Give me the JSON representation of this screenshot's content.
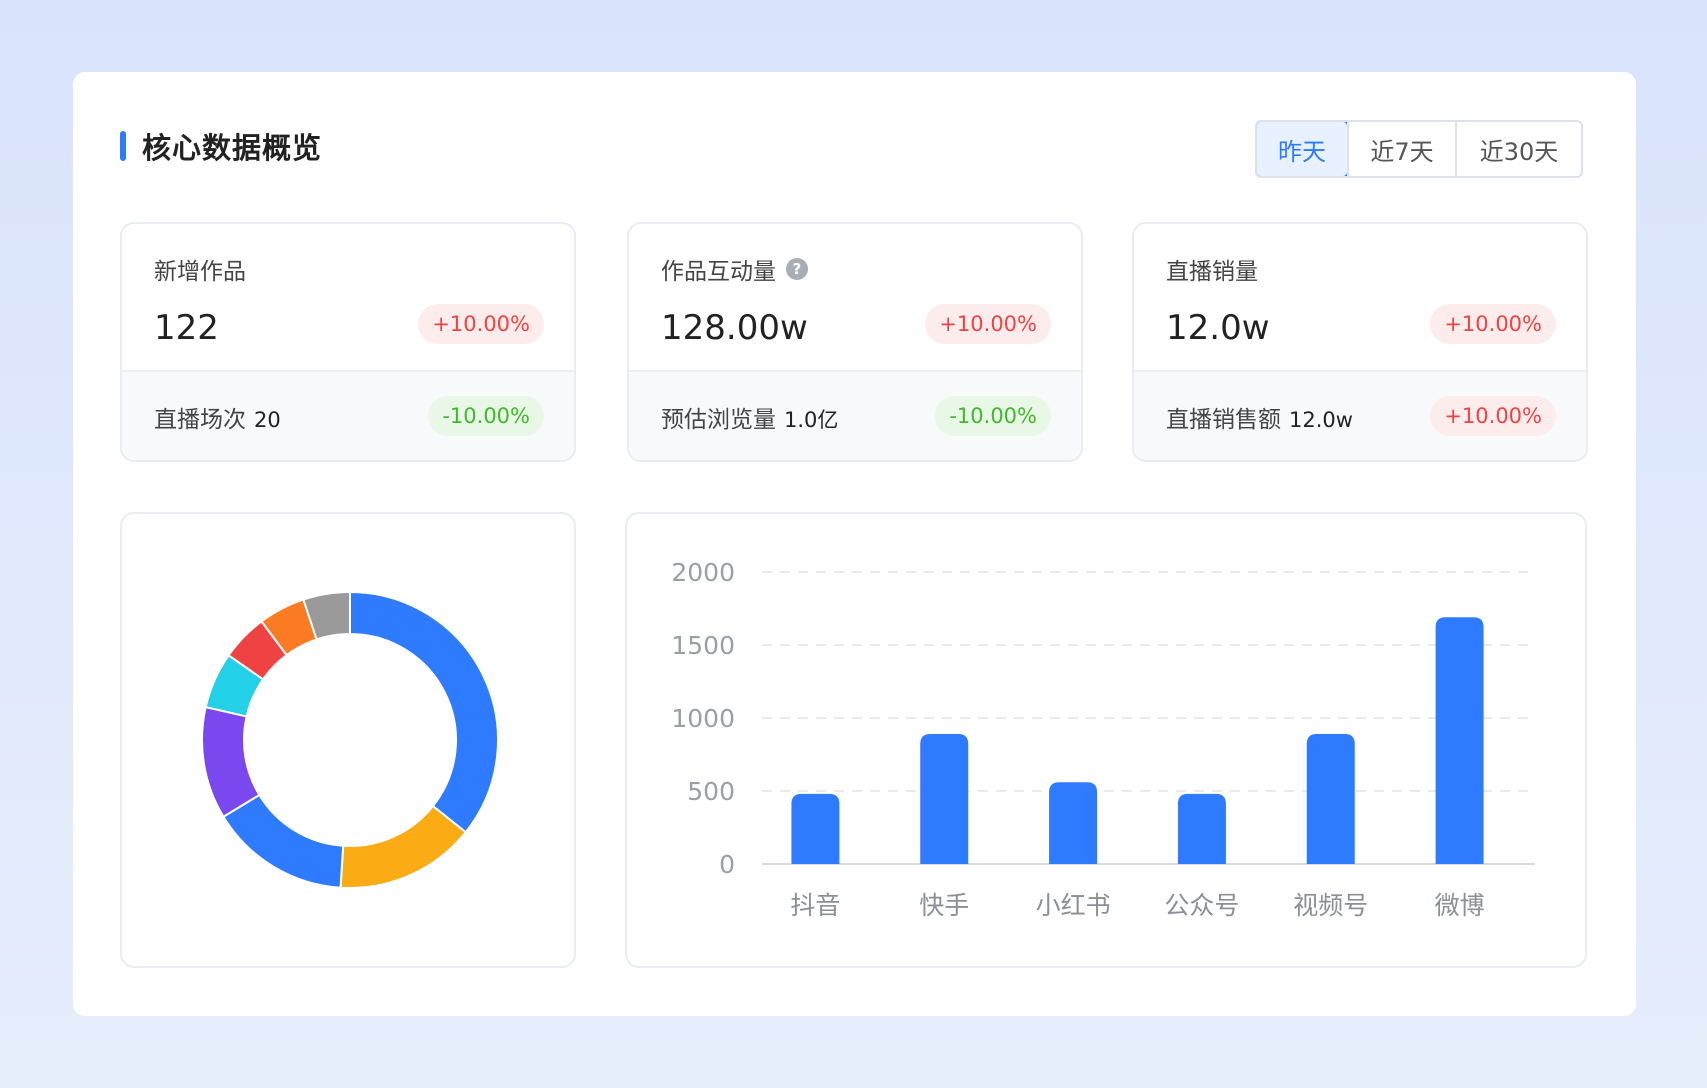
{
  "header": {
    "title": "核心数据概览",
    "tabs": [
      {
        "label": "昨天",
        "active": true
      },
      {
        "label": "近7天",
        "active": false
      },
      {
        "label": "近30天",
        "active": false
      }
    ]
  },
  "kpis": [
    {
      "label": "新增作品",
      "value": "122",
      "change": "+10.00%",
      "trend": "up",
      "help": false,
      "sub_label": "直播场次",
      "sub_value": "20",
      "sub_change": "-10.00%",
      "sub_trend": "down"
    },
    {
      "label": "作品互动量",
      "value": "128.00w",
      "change": "+10.00%",
      "trend": "up",
      "help": true,
      "sub_label": "预估浏览量",
      "sub_value": "1.0亿",
      "sub_change": "-10.00%",
      "sub_trend": "down"
    },
    {
      "label": "直播销量",
      "value": "12.0w",
      "change": "+10.00%",
      "trend": "up",
      "help": false,
      "sub_label": "直播销售额",
      "sub_value": "12.0w",
      "sub_change": "+10.00%",
      "sub_trend": "up"
    }
  ],
  "colors": {
    "accent": "#2f7bff",
    "up": "#ef4343",
    "down": "#3fb92b"
  },
  "chart_data": [
    {
      "type": "pie",
      "donut": true,
      "values": [
        35,
        15,
        15,
        12,
        6,
        5,
        5,
        5
      ],
      "colors": [
        "#2f7bff",
        "#fbab14",
        "#2f7bff",
        "#7b47ee",
        "#22d1e8",
        "#ef4343",
        "#fb7b25",
        "#9a9a9a"
      ]
    },
    {
      "type": "bar",
      "categories": [
        "抖音",
        "快手",
        "小红书",
        "公众号",
        "视频号",
        "微博"
      ],
      "values": [
        480,
        890,
        560,
        480,
        890,
        1690
      ],
      "ylim": [
        0,
        2000
      ],
      "yticks": [
        0,
        500,
        1000,
        1500,
        2000
      ],
      "grid": true,
      "color": "#2f7bff"
    }
  ]
}
